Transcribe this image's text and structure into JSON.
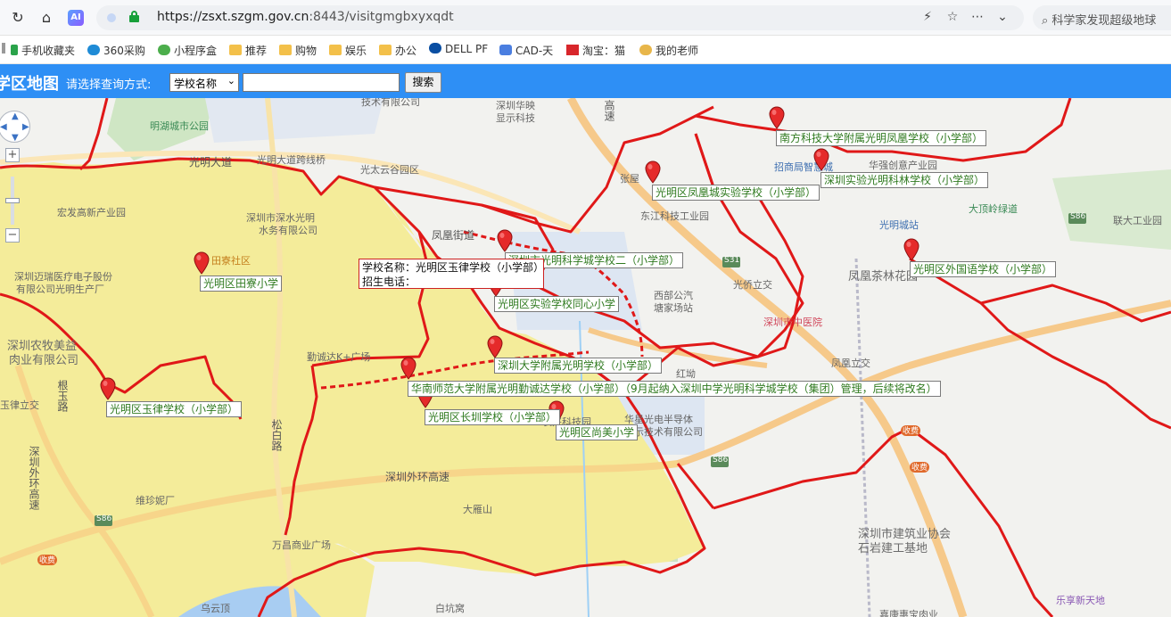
{
  "browser": {
    "url_host": "https://zsxt.szgm.gov.cn",
    "url_rest": ":8443/visitgmgbxyxqdt",
    "ai_badge": "AI",
    "side_search": "科学家发现超级地球"
  },
  "bookmarks": [
    {
      "label": "手机收藏夹",
      "icon": "phone-icon"
    },
    {
      "label": "360采购",
      "icon": "360-icon"
    },
    {
      "label": "小程序盒",
      "icon": "miniapp-icon"
    },
    {
      "label": "推荐",
      "icon": "folder-icon"
    },
    {
      "label": "购物",
      "icon": "folder-icon"
    },
    {
      "label": "娱乐",
      "icon": "folder-icon"
    },
    {
      "label": "办公",
      "icon": "folder-icon"
    },
    {
      "label": "DELL PF",
      "icon": "dell-icon"
    },
    {
      "label": "CAD-天",
      "icon": "cad-icon"
    },
    {
      "label": "淘宝：猫",
      "icon": "adobe-icon"
    },
    {
      "label": "我的老师",
      "icon": "teacher-icon"
    }
  ],
  "app": {
    "title": "学区地图",
    "query_label": "请选择查询方式:",
    "query_select_value": "学校名称",
    "search_value": "",
    "search_button": "搜索"
  },
  "tooltip": {
    "line1": "学校名称：光明区玉律学校（小学部）",
    "line2": "招生电话："
  },
  "schools": [
    "南方科技大学附属光明凤凰学校（小学部）",
    "深圳实验光明科林学校（小学部）",
    "光明区凤凰城实验学校（小学部）",
    "深圳市光明科学城学校二（小学部）",
    "光明区外国语学校（小学部）",
    "光明区田寮小学",
    "光明区实验学校同心小学",
    "深圳大学附属光明学校（小学部）",
    "华南师范大学附属光明勤诚达学校（小学部）（9月起纳入深圳中学光明科学城学校（集团）管理，后续将改名）",
    "光明区玉律学校（小学部）",
    "光明区长圳学校（小学部）",
    "光明区尚美小学"
  ],
  "poi": {
    "mingwei_park": "明湖城市公园",
    "guangming_ave": "光明大道",
    "guangming_cross_bridge": "光明大道跨线桥",
    "taiyun_park": "光太云谷园区",
    "shuiwu": "深圳市深水光明",
    "shuiwu2": "水务有限公司",
    "hongfa": "宏发高新产业园",
    "maipu": "深圳迈瑞医疗电子股份",
    "maipu2": "有限公司光明生产厂",
    "tianliao": "田寮社区",
    "nongmu": "深圳农牧美益",
    "nongmu2": "肉业有限公司",
    "genyu": "根玉路",
    "yulv_interchange": "玉律立交",
    "songbai": "松白路",
    "waihuan": "深圳外环高速",
    "outer_ring": "深圳外环高速",
    "dayan": "大雁山",
    "weizhen": "维珍妮厂",
    "wanchang": "万昌商业广场",
    "wuyun": "乌云顶",
    "baikengwo": "白坑窝",
    "qindasl": "勤诚达K+广场",
    "fenghuang_jiedao": "凤凰街道",
    "huaying": "深圳华映",
    "huaying2": "显示科技",
    "jishu": "技术有限公司",
    "zhangwu": "张屋",
    "dongjiang": "东江科技工业园",
    "zhaoshang": "招商局智慧城",
    "huaqiang": "华强创意产业园",
    "dadingling": "大顶岭绿道",
    "lianda": "联大工业园",
    "guangming_station": "光明城站",
    "fenghuang_chalin": "凤凰茶林花园",
    "xibu_bus": "西部公汽",
    "xibu_bus2": "塘家场站",
    "guangqiao": "光侨立交",
    "zhongyi": "深圳市中医院",
    "fenghuang_interchange": "凤凰立交",
    "hongtian": "红坳",
    "huaxing": "华星光电半导体",
    "huaxing2": "显示技术有限公司",
    "jianzhu": "深圳市建筑业协会",
    "jianzhu2": "石岩建工基地",
    "lexiang": "乐享新天地",
    "jiasheng": "嘉康惠宝肉业",
    "changxing": "长兴科技园",
    "s31": "S31",
    "s86a": "S86",
    "s86b": "S86",
    "s86c": "S86",
    "toll1": "收费",
    "toll2": "收费",
    "toll3": "收费",
    "highway_label": "高速",
    "shenzhen_tag": "深圳"
  },
  "map_controls": {
    "zoom_in": "+",
    "zoom_out": "−"
  },
  "colors": {
    "app_bar": "#2e8ff5",
    "district_fill": "#f4ec9a",
    "boundary": "#e01818",
    "school_label": "#2f7a1f",
    "marker": "#e52a2a"
  }
}
